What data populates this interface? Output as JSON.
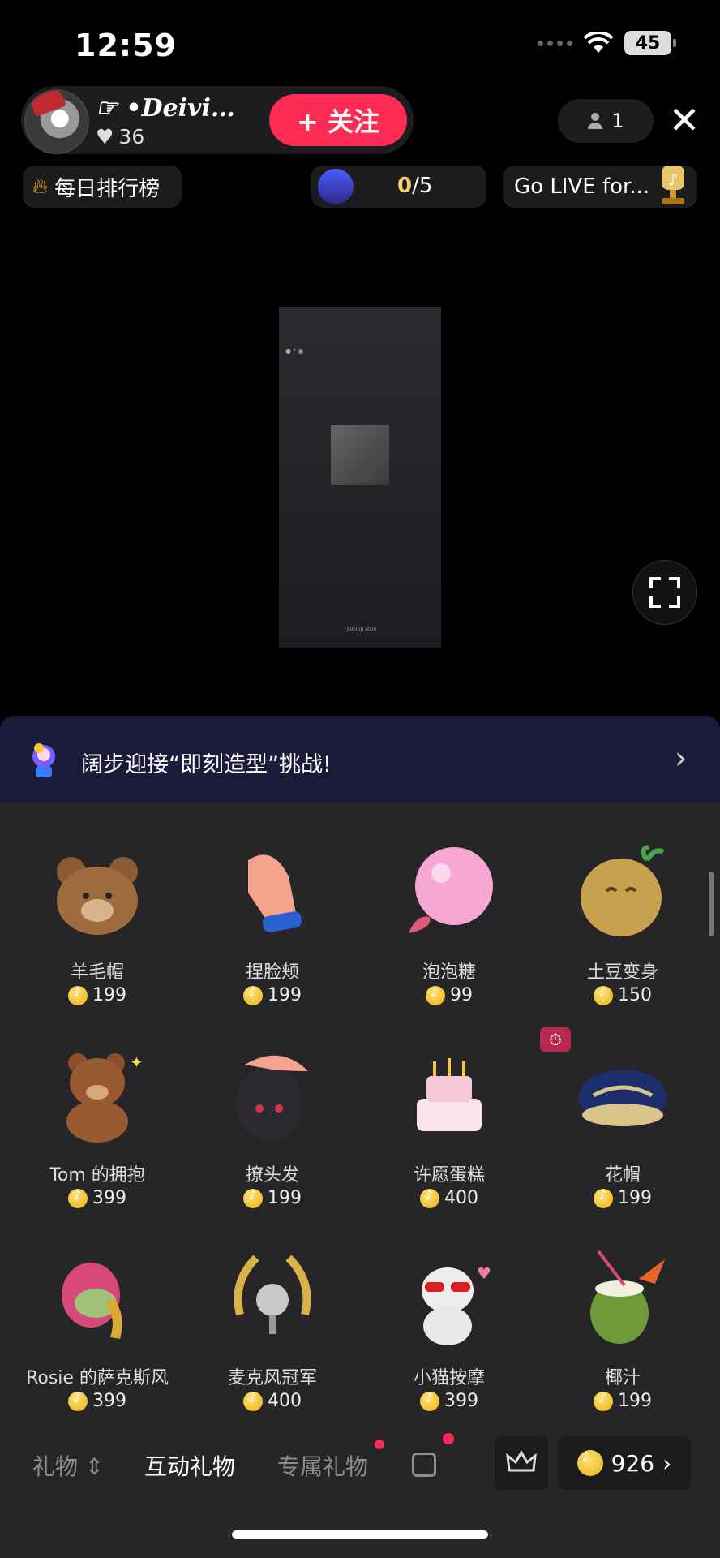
{
  "status": {
    "time": "12:59",
    "battery": "45"
  },
  "host": {
    "name": "☞ •𝑫𝒆𝒊𝒗𝒊…",
    "likes": "36",
    "follow_label": "+ 关注"
  },
  "viewers": "1",
  "ranking": {
    "label": "每日排行榜"
  },
  "goal": {
    "current": "0",
    "total": "/5"
  },
  "golive": {
    "label": "Go LIVE for..."
  },
  "video": {
    "footer": "Joining soon"
  },
  "banner": {
    "text": "阔步迎接“即刻造型”挑战!"
  },
  "gifts": [
    {
      "name": "羊毛帽",
      "price": "199"
    },
    {
      "name": "捏脸颊",
      "price": "199"
    },
    {
      "name": "泡泡糖",
      "price": "99"
    },
    {
      "name": "土豆变身",
      "price": "150"
    },
    {
      "name": "Tom 的拥抱",
      "price": "399"
    },
    {
      "name": "撩头发",
      "price": "199"
    },
    {
      "name": "许愿蛋糕",
      "price": "400"
    },
    {
      "name": "花帽",
      "price": "199"
    },
    {
      "name": "Rosie 的萨克斯风",
      "price": "399"
    },
    {
      "name": "麦克风冠军",
      "price": "400"
    },
    {
      "name": "小猫按摩",
      "price": "399"
    },
    {
      "name": "椰汁",
      "price": "199"
    }
  ],
  "tabs": {
    "gifts": "礼物 ⇕",
    "interactive": "互动礼物",
    "exclusive": "专属礼物"
  },
  "balance": "926"
}
